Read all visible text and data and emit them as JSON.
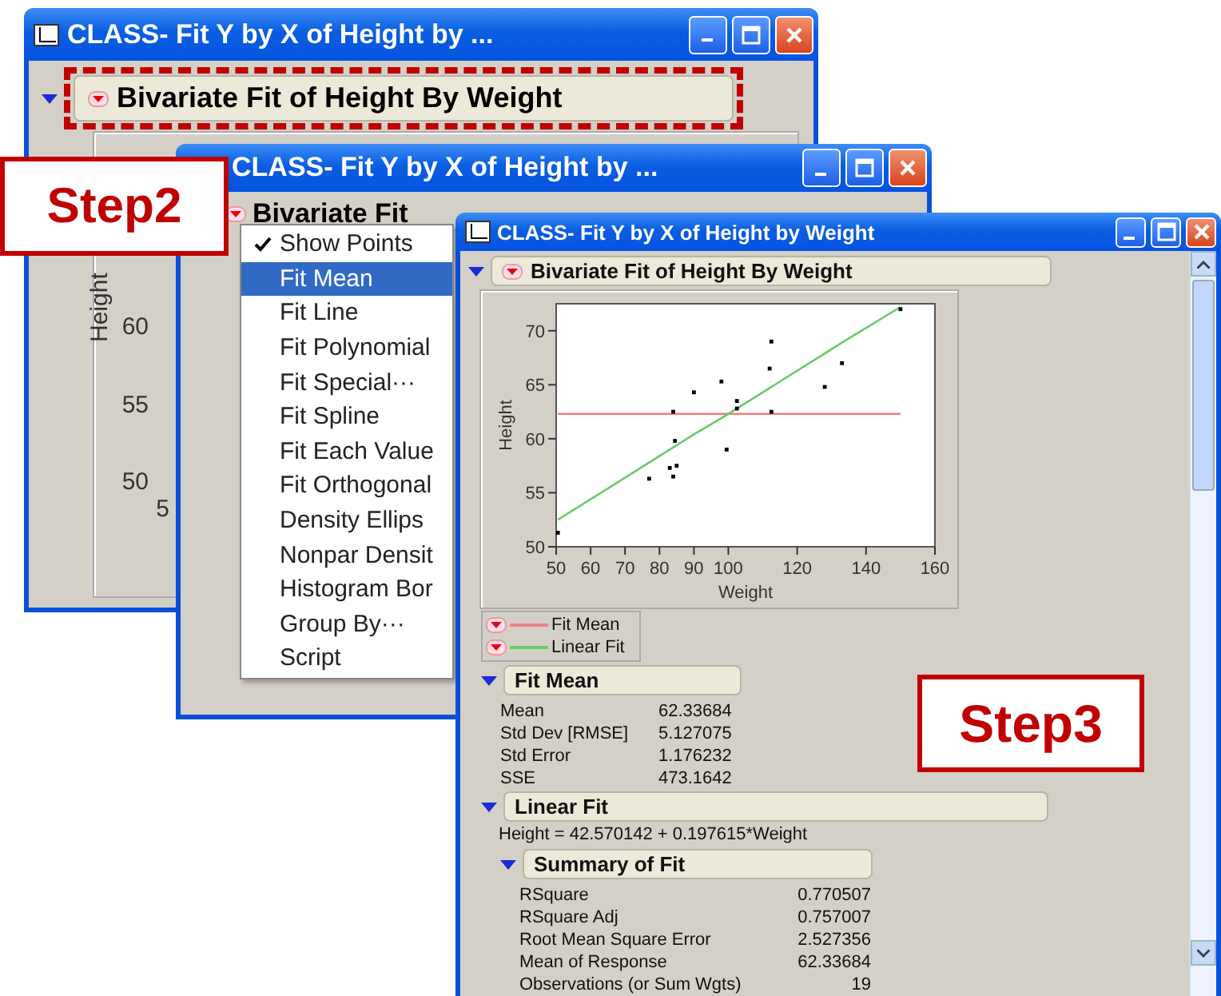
{
  "back_window": {
    "title": "CLASS- Fit Y by X of Height by ...",
    "report_header": "Bivariate Fit of Height By Weight",
    "expanded": true,
    "highlighted": true,
    "y_axis_label": "Height",
    "y_ticks": [
      "60",
      "55",
      "50"
    ],
    "x_tick": "5"
  },
  "middle_window": {
    "title": "CLASS- Fit Y by X of Height by ...",
    "report_header": "Bivariate Fit",
    "menu": [
      {
        "label": "Show Points",
        "checked": true,
        "selected": false
      },
      {
        "label": "Fit Mean",
        "checked": false,
        "selected": true
      },
      {
        "label": "Fit Line",
        "checked": false,
        "selected": false
      },
      {
        "label": "Fit Polynomial",
        "checked": false,
        "selected": false
      },
      {
        "label": "Fit Special···",
        "checked": false,
        "selected": false
      },
      {
        "label": "Fit Spline",
        "checked": false,
        "selected": false
      },
      {
        "label": "Fit Each Value",
        "checked": false,
        "selected": false
      },
      {
        "label": "Fit Orthogonal",
        "checked": false,
        "selected": false
      },
      {
        "label": "Density Ellips",
        "checked": false,
        "selected": false
      },
      {
        "label": "Nonpar Densit",
        "checked": false,
        "selected": false
      },
      {
        "label": "Histogram Bor",
        "checked": false,
        "selected": false
      },
      {
        "label": "Group By···",
        "checked": false,
        "selected": false
      },
      {
        "label": "Script",
        "checked": false,
        "selected": false
      }
    ]
  },
  "front_window": {
    "title": "CLASS- Fit Y by X of Height by Weight",
    "report_header": "Bivariate Fit of Height By Weight",
    "expanded": true,
    "chart_data": {
      "type": "scatter",
      "xlabel": "Weight",
      "ylabel": "Height",
      "xlim": [
        50,
        160
      ],
      "ylim": [
        50,
        72.5
      ],
      "xticks": [
        50,
        60,
        70,
        80,
        90,
        100,
        120,
        140,
        160
      ],
      "yticks": [
        50,
        55,
        60,
        65,
        70
      ],
      "x": [
        50.5,
        77,
        83,
        84,
        84,
        84.5,
        85,
        90,
        98,
        99.5,
        102.5,
        102.5,
        112,
        112,
        112.5,
        112.5,
        128,
        133,
        150
      ],
      "series": [
        {
          "type": "scatter",
          "color": "#000000",
          "values": [
            51.3,
            56.3,
            57.3,
            56.5,
            62.5,
            59.8,
            57.5,
            64.3,
            65.3,
            59.0,
            62.8,
            63.5,
            66.5,
            null,
            62.5,
            69.0,
            64.8,
            67.0,
            72.0
          ]
        },
        {
          "name": "Fit Mean",
          "type": "line",
          "color": "#f08080",
          "values": [
            62.3,
            62.3,
            62.3,
            62.3,
            62.3,
            62.3,
            62.3,
            62.3,
            62.3,
            62.3,
            62.3,
            62.3,
            62.3,
            62.3,
            62.3,
            62.3,
            62.3,
            62.3,
            62.3
          ]
        },
        {
          "name": "Linear Fit",
          "type": "line",
          "color": "#66cc66",
          "values": [
            52.5,
            57.8,
            59.0,
            59.2,
            59.2,
            59.3,
            59.4,
            60.4,
            61.9,
            62.2,
            62.8,
            62.8,
            64.7,
            64.7,
            64.8,
            64.8,
            67.9,
            68.9,
            72.2
          ]
        }
      ]
    },
    "fit_mean": {
      "title": "Fit Mean",
      "expanded": true,
      "rows": [
        {
          "label": "Mean",
          "value": "62.33684"
        },
        {
          "label": "Std Dev [RMSE]",
          "value": "5.127075"
        },
        {
          "label": "Std Error",
          "value": "1.176232"
        },
        {
          "label": "SSE",
          "value": "473.1642"
        }
      ]
    },
    "linear_fit": {
      "title": "Linear Fit",
      "expanded": true,
      "equation": "Height = 42.570142 + 0.197615*Weight",
      "summary": {
        "title": "Summary of Fit",
        "expanded": true,
        "rows": [
          {
            "label": "RSquare",
            "value": "0.770507"
          },
          {
            "label": "RSquare Adj",
            "value": "0.757007"
          },
          {
            "label": "Root Mean Square Error",
            "value": "2.527356"
          },
          {
            "label": "Mean of Response",
            "value": "62.33684"
          },
          {
            "label": "Observations (or Sum Wgts)",
            "value": "19"
          }
        ]
      }
    }
  },
  "callouts": [
    {
      "label": "Step2"
    },
    {
      "label": "Step3"
    }
  ]
}
